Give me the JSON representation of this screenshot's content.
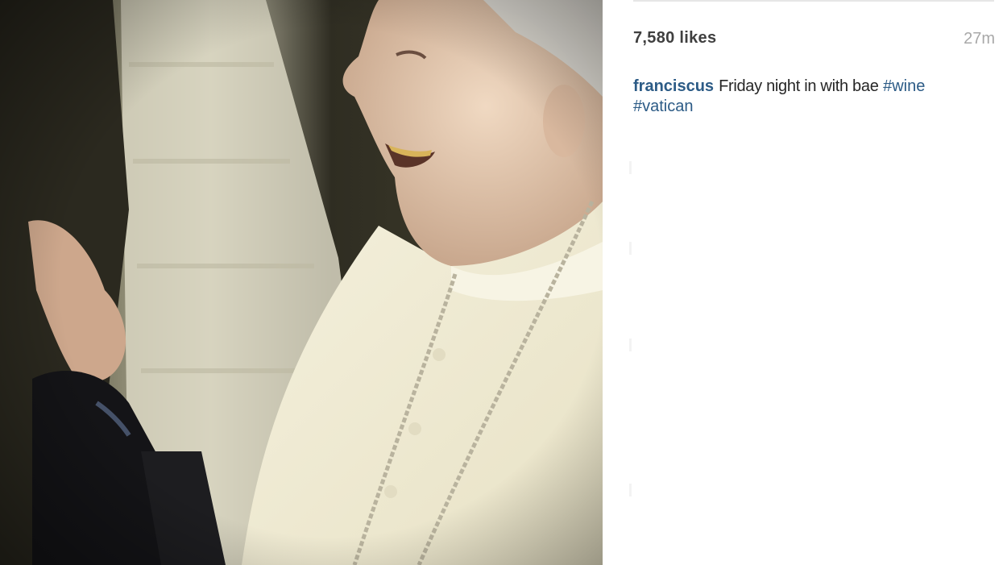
{
  "post": {
    "likes": "7,580 likes",
    "time_ago": "27m",
    "caption": {
      "username": "franciscus",
      "text": "Friday night in with bae",
      "hashtags": [
        "#wine",
        "#vatican"
      ]
    },
    "photo_icon": "photo-image"
  },
  "colors": {
    "link": "#2c5b86",
    "likes_text": "#3f3f3f",
    "timestamp": "#a8a8a8"
  }
}
